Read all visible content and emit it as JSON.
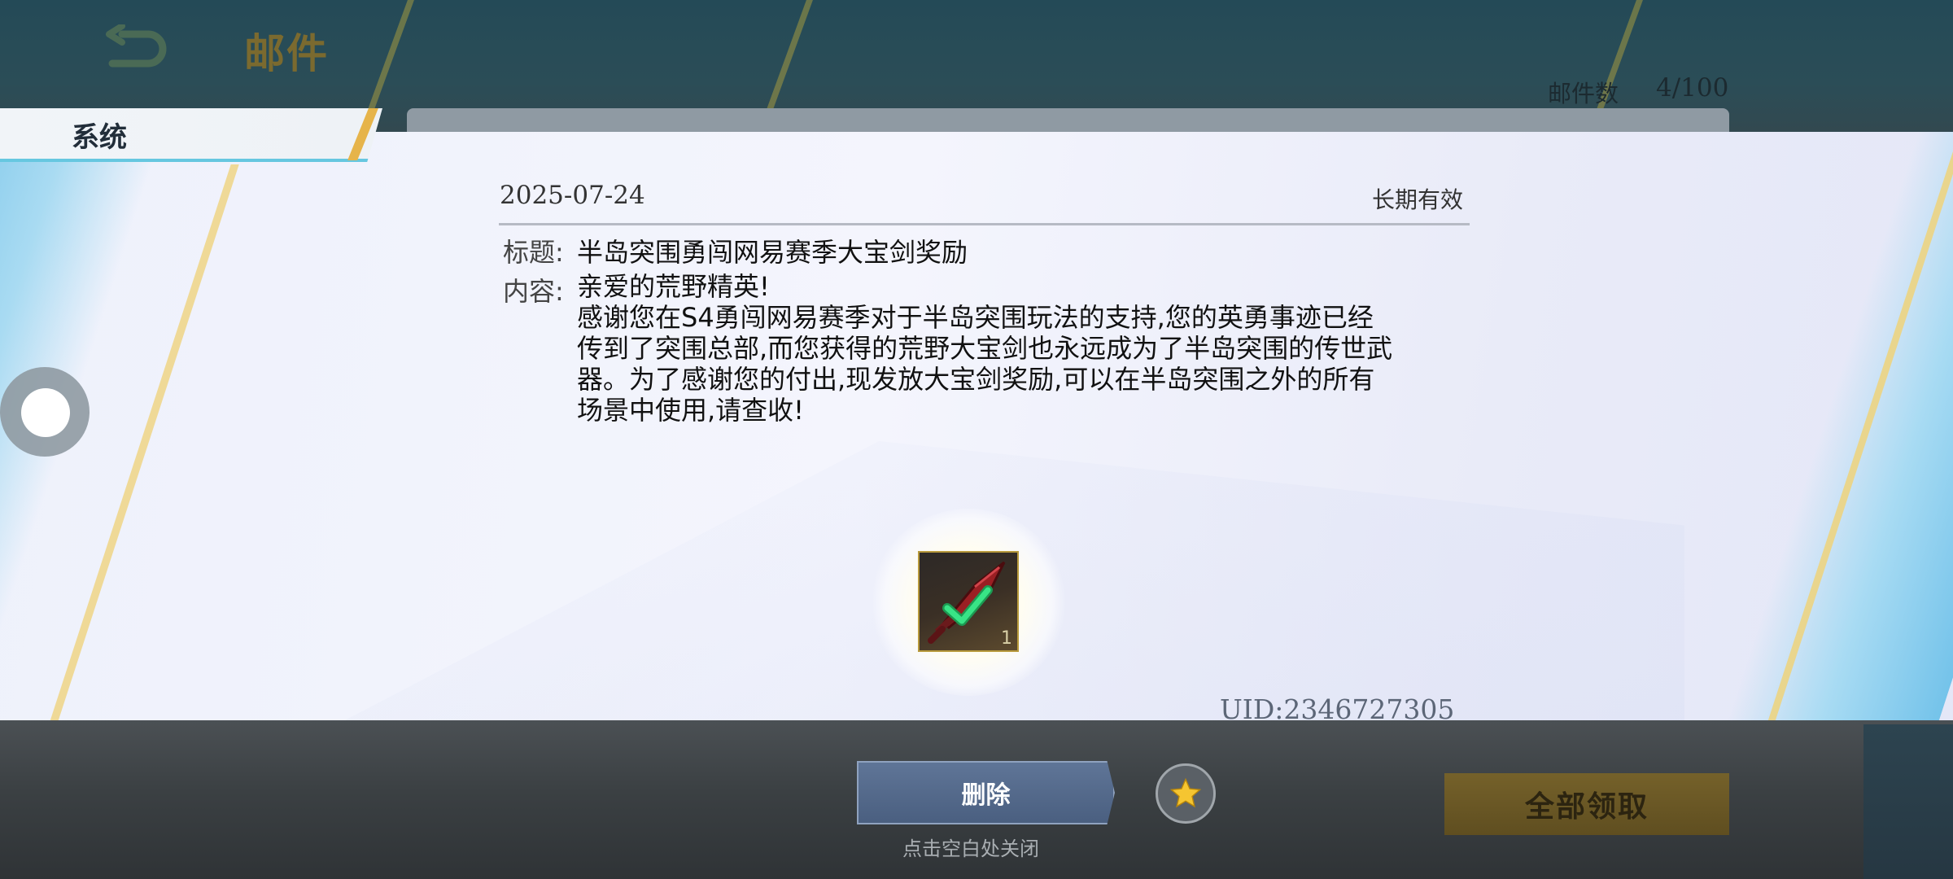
{
  "header": {
    "title": "邮件",
    "back_icon": "back-arrow-icon",
    "mail_count_label": "邮件数",
    "mail_count_value": "4/100"
  },
  "tabs": [
    {
      "label": "系统",
      "selected": true
    }
  ],
  "mail": {
    "date": "2025-07-24",
    "validity": "长期有效",
    "subject_label": "标题:",
    "subject": "半岛突围勇闯网易赛季大宝剑奖励",
    "content_label": "内容:",
    "content": "亲爱的荒野精英!\n感谢您在S4勇闯网易赛季对于半岛突围玩法的支持,您的英勇事迹已经\n传到了突围总部,而您获得的荒野大宝剑也永远成为了半岛突围的传世武\n器。为了感谢您的付出,现发放大宝剑奖励,可以在半岛突围之外的所有\n场景中使用,请查收!"
  },
  "reward": {
    "item_icon": "sword-icon",
    "claimed_icon": "checkmark-icon",
    "quantity": "1",
    "claimed": true
  },
  "uid": "UID:2346727305",
  "actions": {
    "delete_label": "删除",
    "tap_close_hint": "点击空白处关闭",
    "favorite_icon": "star-icon",
    "claim_all_label": "全部领取"
  },
  "colors": {
    "accent_gold": "#e6b44a",
    "tab_underline": "#66c7e0",
    "delete_button": "#5a7092",
    "claim_all_button": "#6b5826",
    "check_green": "#2ee07a"
  }
}
